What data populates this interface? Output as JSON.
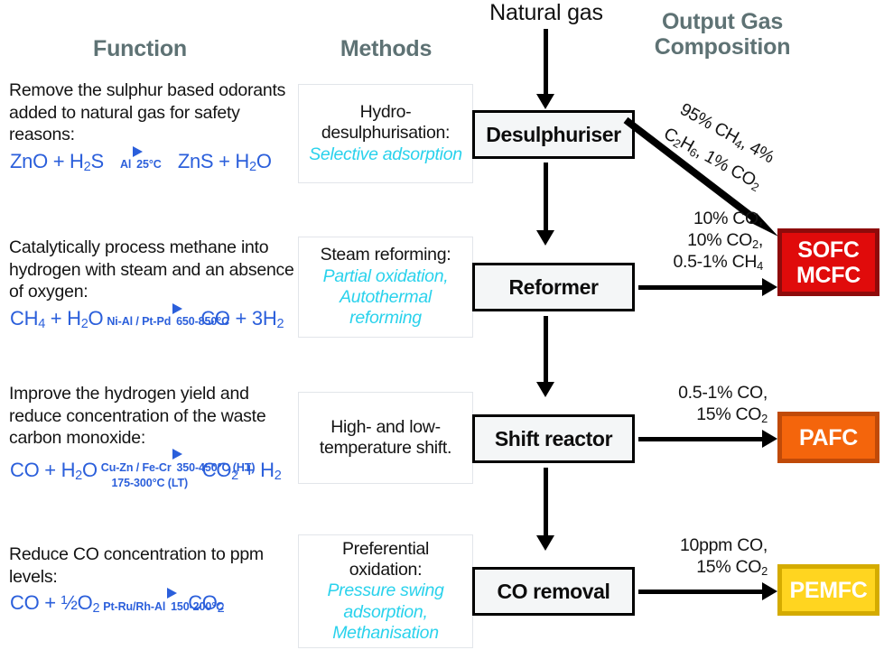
{
  "headers": {
    "function": "Function",
    "methods": "Methods",
    "output": "Output Gas Composition",
    "source": "Natural gas"
  },
  "colors": {
    "header_text": "#5e7274",
    "reaction_blue": "#2b5fdb",
    "methods_alt_cyan": "#2ad2ec",
    "sofc_red": "#e00b0b",
    "sofc_red_border": "#8e0b0b",
    "pafc_orange": "#f4650c",
    "pafc_orange_border": "#c04a08",
    "pemfc_yellow": "#ffd520",
    "pemfc_yellow_border": "#d4ab00",
    "process_box_fill": "#f4f6f7",
    "process_box_border": "#000000"
  },
  "rows": [
    {
      "function_text": "Remove the sulphur based odorants added to natural gas for safety reasons:",
      "reaction": {
        "left": "ZnO + H₂S",
        "above": "Al",
        "below": "25°C",
        "below2": "",
        "right": "ZnS + H₂O"
      },
      "method_main": "Hydro-desulphurisation:",
      "method_alt": "Selective adsorption",
      "process": "Desulphuriser",
      "output_label": "95% CH₄, 4% C₂H₆, 1% CO₂"
    },
    {
      "function_text": "Catalytically process methane into hydrogen with steam and an absence of oxygen:",
      "reaction": {
        "left": "CH₄ + H₂O",
        "above": "Ni-Al / Pt-Pd",
        "below": "650-850°C",
        "below2": "",
        "right": "CO + 3H₂"
      },
      "method_main": "Steam reforming:",
      "method_alt": "Partial oxidation, Autothermal reforming",
      "process": "Reformer",
      "output_label": "10% CO, 10% CO₂, 0.5-1% CH₄"
    },
    {
      "function_text": "Improve the hydrogen yield and reduce concentration of the waste carbon monoxide:",
      "reaction": {
        "left": "CO + H₂O",
        "above": "Cu-Zn / Fe-Cr",
        "below": "350-450°C (HT)",
        "below2": "175-300°C (LT)",
        "right": "CO₂ + H₂"
      },
      "method_main": "High- and low-temperature shift.",
      "method_alt": "",
      "process": "Shift reactor",
      "output_label": "0.5-1% CO, 15% CO₂"
    },
    {
      "function_text": "Reduce CO concentration to ppm levels:",
      "reaction": {
        "left": "CO + ½O₂",
        "above": "Pt-Ru/Rh-Al",
        "below": "150-200°C",
        "below2": "",
        "right": "CO₂"
      },
      "method_main": "Preferential oxidation:",
      "method_alt": "Pressure swing adsorption, Methanisation",
      "process": "CO removal",
      "output_label": "10ppm CO, 15% CO₂"
    }
  ],
  "output_labels": {
    "diagonal_line1": "95% CH₄, 4%",
    "diagonal_line2": "C₂H₆, 1% CO₂",
    "reformer_line1": "10% CO,",
    "reformer_line2": "10% CO₂,",
    "reformer_line3": "0.5-1% CH₄",
    "shift_line1": "0.5-1% CO,",
    "shift_line2": "15% CO₂",
    "coremoval_line1": "10ppm CO,",
    "coremoval_line2": "15% CO₂"
  },
  "fuel_cells": [
    {
      "lines": [
        "SOFC",
        "MCFC"
      ],
      "name": "sofc-mcfc"
    },
    {
      "lines": [
        "PAFC"
      ],
      "name": "pafc"
    },
    {
      "lines": [
        "PEMFC"
      ],
      "name": "pemfc"
    }
  ],
  "icons": {
    "down_arrow": "down-arrow-icon",
    "right_arrow": "right-arrow-icon",
    "diagonal_arrow": "diagonal-arrow-icon",
    "reaction_arrow": "reaction-arrow-icon"
  }
}
